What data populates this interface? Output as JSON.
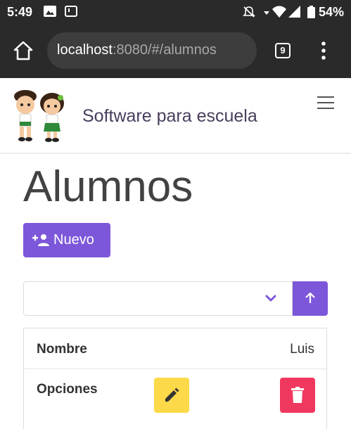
{
  "status_bar": {
    "time": "5:49",
    "battery": "54%"
  },
  "browser": {
    "url_host": "localhost",
    "url_path": ":8080/#/alumnos",
    "tab_count": "9"
  },
  "header": {
    "app_title": "Software para escuela"
  },
  "main": {
    "page_title": "Alumnos",
    "new_button_label": "Nuevo",
    "sort_select_value": ""
  },
  "student_card": {
    "name_label": "Nombre",
    "name_value": "Luis",
    "options_label": "Opciones"
  },
  "colors": {
    "primary": "#7d57d9",
    "edit": "#fcd948",
    "delete": "#f0385e",
    "title_text": "#4a3d5c"
  },
  "icons": [
    "image-icon",
    "notification-icon",
    "mute-icon",
    "wifi-icon",
    "signal-icon",
    "battery-icon",
    "home-icon",
    "more-vertical-icon",
    "hamburger-menu-icon",
    "add-person-icon",
    "chevron-down-icon",
    "arrow-up-icon",
    "pencil-icon",
    "trash-icon"
  ]
}
